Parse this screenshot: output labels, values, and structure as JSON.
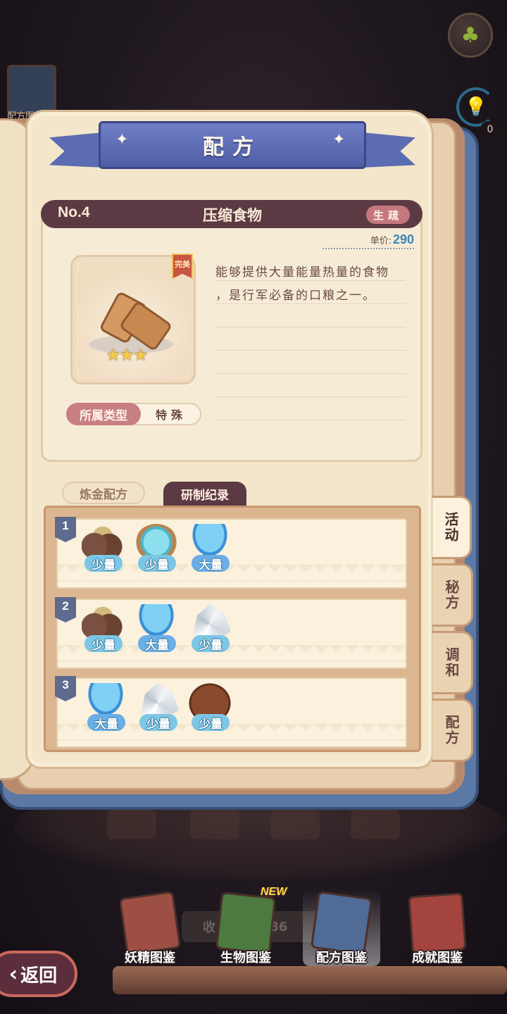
{
  "topbar": {
    "recipe_shortcut_label": "配方图",
    "hint_count": "0"
  },
  "book": {
    "title": "配方",
    "item": {
      "number": "No.4",
      "name": "压缩食物",
      "category_badge": "生疏",
      "price_label": "单价:",
      "price_value": "290",
      "quality_tag": "完美",
      "stars": "★★★",
      "description_lines": [
        "能够提供大量能量热量的食物",
        "，是行军必备的口粮之一。",
        "",
        "",
        "",
        "",
        ""
      ],
      "type_label": "所属类型",
      "type_value": "特殊"
    },
    "tabs": [
      {
        "label": "炼金配方",
        "active": false
      },
      {
        "label": "研制纪录",
        "active": true
      }
    ],
    "records": [
      {
        "num": "1",
        "ingredients": [
          {
            "icon": "ore-icon",
            "qty": "少量"
          },
          {
            "icon": "pond-icon",
            "qty": "少量"
          },
          {
            "icon": "jellyfish-icon",
            "qty": "大量"
          }
        ]
      },
      {
        "num": "2",
        "ingredients": [
          {
            "icon": "ore-icon",
            "qty": "少量"
          },
          {
            "icon": "jellyfish-icon",
            "qty": "大量"
          },
          {
            "icon": "crystal-icon",
            "qty": "少量"
          }
        ]
      },
      {
        "num": "3",
        "ingredients": [
          {
            "icon": "jellyfish-icon",
            "qty": "大量"
          },
          {
            "icon": "crystal-icon",
            "qty": "少量"
          },
          {
            "icon": "dirt-icon",
            "qty": "少量"
          }
        ]
      }
    ],
    "side_tabs": [
      "活动",
      "秘方",
      "调和",
      "配方"
    ]
  },
  "bottom_nav": {
    "collection_counter": "收",
    "collection_counter_suffix": "/186",
    "new_badge": "NEW",
    "items": [
      {
        "label": "妖精图鉴",
        "icon": "fairy-book-icon"
      },
      {
        "label": "生物图鉴",
        "icon": "creature-book-icon"
      },
      {
        "label": "配方图鉴",
        "icon": "recipe-book-icon"
      },
      {
        "label": "成就图鉴",
        "icon": "achievement-book-icon"
      }
    ],
    "back_label": "返回"
  },
  "colors": {
    "ribbon": "#5c6cb2",
    "header": "#5c3a44",
    "price": "#3a86b5",
    "badge": "#c4787d",
    "qty": "#7cc6e6"
  }
}
